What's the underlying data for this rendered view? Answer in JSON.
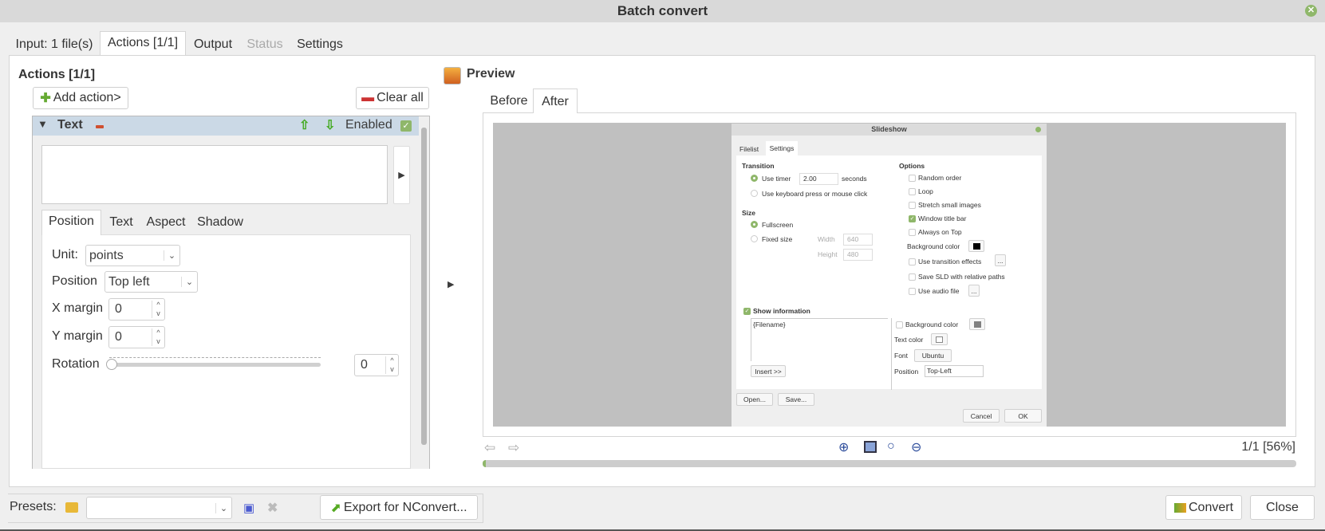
{
  "window": {
    "title": "Batch convert"
  },
  "tabs": [
    {
      "label": "Input: 1 file(s)"
    },
    {
      "label": "Actions [1/1]"
    },
    {
      "label": "Output"
    },
    {
      "label": "Status"
    },
    {
      "label": "Settings"
    }
  ],
  "actions": {
    "heading": "Actions [1/1]",
    "add_label": "Add action>",
    "clear_label": "Clear all",
    "action": {
      "name": "Text",
      "enabled_label": "Enabled",
      "enabled": true,
      "text_value": "",
      "subtabs": [
        "Position",
        "Text",
        "Aspect",
        "Shadow"
      ],
      "unit_label": "Unit:",
      "unit_value": "points",
      "position_label": "Position",
      "position_value": "Top left",
      "xmargin_label": "X margin",
      "xmargin_value": "0",
      "ymargin_label": "Y margin",
      "ymargin_value": "0",
      "rotation_label": "Rotation",
      "rotation_value": "0"
    }
  },
  "preview": {
    "title": "Preview",
    "tabs": [
      "Before",
      "After"
    ],
    "page_info": "1/1 [56%]",
    "progress": 0,
    "dialog": {
      "title": "Slideshow",
      "tabs": [
        "Filelist",
        "Settings"
      ],
      "transition_label": "Transition",
      "use_timer": "Use timer",
      "timer_value": "2.00",
      "seconds": "seconds",
      "use_keyboard": "Use keyboard press or mouse click",
      "size_label": "Size",
      "fullscreen": "Fullscreen",
      "fixed_size": "Fixed size",
      "width_label": "Width",
      "width_value": "640",
      "height_label": "Height",
      "height_value": "480",
      "options_label": "Options",
      "options": [
        {
          "label": "Random order",
          "checked": false
        },
        {
          "label": "Loop",
          "checked": false
        },
        {
          "label": "Stretch small images",
          "checked": false
        },
        {
          "label": "Window title bar",
          "checked": true
        },
        {
          "label": "Always on Top",
          "checked": false
        }
      ],
      "bg_color_label": "Background color",
      "use_transition": "Use transition effects",
      "save_sld": "Save SLD with relative paths",
      "use_audio": "Use audio file",
      "ellipsis": "...",
      "show_info": "Show information",
      "info_text": "{Filename}",
      "insert_label": "Insert >>",
      "info_bg_color": "Background color",
      "text_color": "Text color",
      "font_label": "Font",
      "font_value": "Ubuntu",
      "position_label": "Position",
      "position_value": "Top-Left",
      "open_label": "Open...",
      "save_label": "Save...",
      "cancel_label": "Cancel",
      "ok_label": "OK"
    }
  },
  "bottom": {
    "presets_label": "Presets:",
    "preset_value": "",
    "export_label": "Export for NConvert...",
    "convert_label": "Convert",
    "close_label": "Close"
  },
  "colors": {
    "accent": "#8fb76a",
    "header": "#cbd9e6"
  }
}
